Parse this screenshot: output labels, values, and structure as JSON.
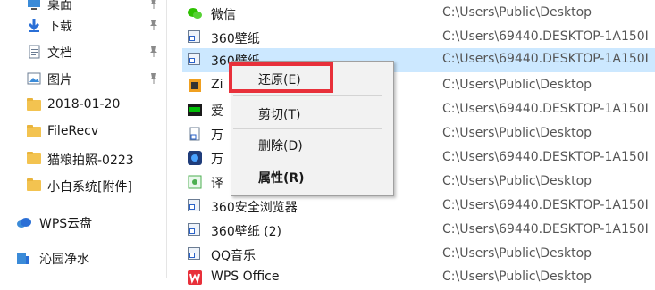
{
  "nav": {
    "items": [
      {
        "label": "桌面",
        "pinned": true
      },
      {
        "label": "下载",
        "pinned": true
      },
      {
        "label": "文档",
        "pinned": true
      },
      {
        "label": "图片",
        "pinned": true
      },
      {
        "label": "2018-01-20"
      },
      {
        "label": "FileRecv"
      },
      {
        "label": "猫粮拍照-0223"
      },
      {
        "label": "小白系统[附件]"
      },
      {
        "label": "WPS云盘"
      },
      {
        "label": "沁园净水"
      }
    ]
  },
  "files": [
    {
      "name": "微信",
      "path": "C:\\Users\\Public\\Desktop"
    },
    {
      "name": "360壁纸",
      "path": "C:\\Users\\69440.DESKTOP-1A150I"
    },
    {
      "name": "360壁纸",
      "path": "C:\\Users\\69440.DESKTOP-1A150I",
      "selected": true
    },
    {
      "name": "Zi",
      "path": "C:\\Users\\Public\\Desktop"
    },
    {
      "name": "爱",
      "path": "C:\\Users\\69440.DESKTOP-1A150I"
    },
    {
      "name": "万",
      "path": "C:\\Users\\Public\\Desktop"
    },
    {
      "name": "万",
      "path": "C:\\Users\\69440.DESKTOP-1A150I"
    },
    {
      "name": "译",
      "path": "C:\\Users\\Public\\Desktop"
    },
    {
      "name": "360安全浏览器",
      "path": "C:\\Users\\69440.DESKTOP-1A150I"
    },
    {
      "name": "360壁纸 (2)",
      "path": "C:\\Users\\69440.DESKTOP-1A150I"
    },
    {
      "name": "QQ音乐",
      "path": "C:\\Users\\Public\\Desktop"
    },
    {
      "name": "WPS Office",
      "path": "C:\\Users\\Public\\Desktop"
    }
  ],
  "context_menu": {
    "restore": "还原(E)",
    "cut": "剪切(T)",
    "delete": "删除(D)",
    "properties": "属性(R)"
  },
  "colors": {
    "selection": "#cce8ff",
    "highlight_box": "#e8303a",
    "folder": "#f3c350"
  }
}
